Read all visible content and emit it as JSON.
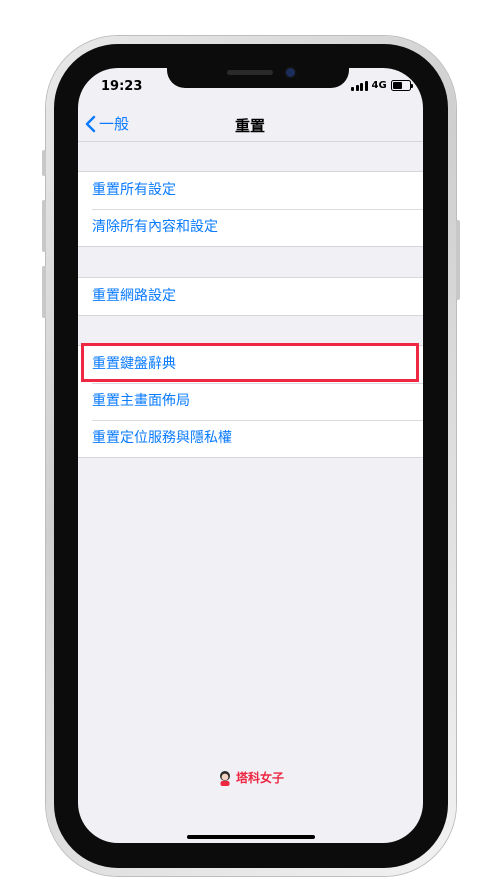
{
  "status_bar": {
    "time": "19:23",
    "network": "4G",
    "battery_level": 0.6
  },
  "nav": {
    "back_label": "一般",
    "title": "重置"
  },
  "groups": [
    {
      "rows": [
        {
          "label": "重置所有設定"
        },
        {
          "label": "清除所有內容和設定"
        }
      ]
    },
    {
      "rows": [
        {
          "label": "重置網路設定"
        }
      ]
    },
    {
      "rows": [
        {
          "label": "重置鍵盤辭典"
        },
        {
          "label": "重置主畫面佈局"
        },
        {
          "label": "重置定位服務與隱私權"
        }
      ]
    }
  ],
  "highlighted_row": "重置鍵盤辭典",
  "watermark": {
    "text": "塔科女子"
  },
  "colors": {
    "accent": "#0a7bff",
    "highlight": "#ee2742",
    "background": "#f0f0f5"
  }
}
